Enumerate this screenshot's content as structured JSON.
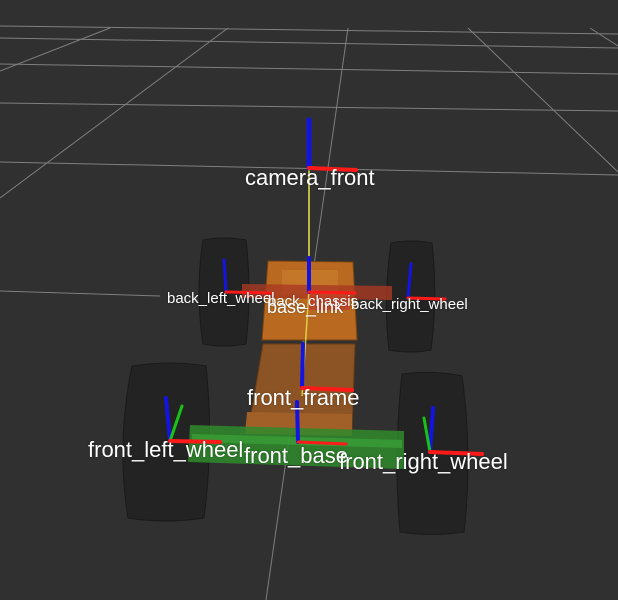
{
  "viewport": {
    "background_color": "#303030",
    "grid_color": "#a0a0a0",
    "axis_colors": {
      "x": "#ff1a1a",
      "y": "#18c018",
      "z": "#1414e0"
    },
    "tf_link_color": "#e8e84a",
    "frames": [
      {
        "key": "camera_front",
        "label": "camera_front"
      },
      {
        "key": "back_left_wheel",
        "label": "back_left_wheel"
      },
      {
        "key": "back_chassis",
        "label": "back_chassis"
      },
      {
        "key": "base_link",
        "label": "base_link"
      },
      {
        "key": "back_right_wheel",
        "label": "back_right_wheel"
      },
      {
        "key": "front_frame",
        "label": "front_frame"
      },
      {
        "key": "front_left_wheel",
        "label": "front_left_wheel"
      },
      {
        "key": "front_base",
        "label": "front_base"
      },
      {
        "key": "front_right_wheel",
        "label": "front_right_wheel"
      }
    ]
  }
}
